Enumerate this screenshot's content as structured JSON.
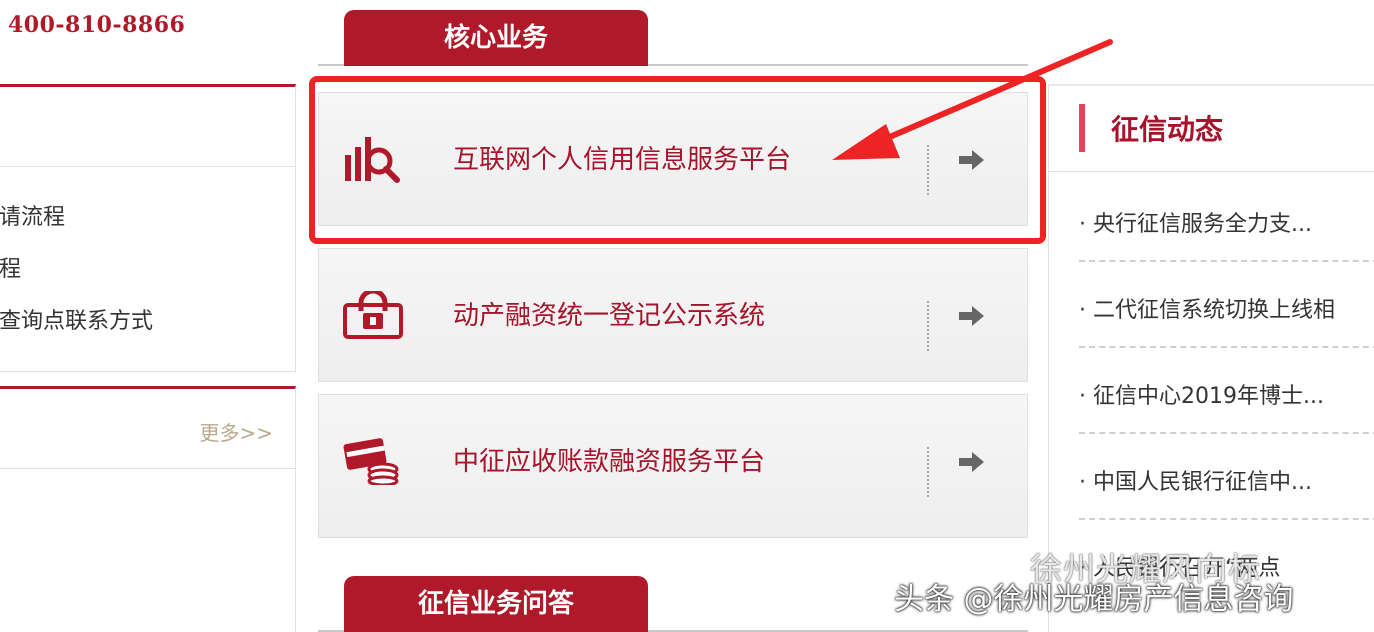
{
  "header": {
    "phone": "400-810-8866"
  },
  "left": {
    "links": [
      "请流程",
      "程",
      "查询点联系方式"
    ],
    "more": "更多>>"
  },
  "center": {
    "tab_top": "核心业务",
    "tab_bottom": "征信业务问答",
    "rows": [
      {
        "label": "互联网个人信用信息服务平台",
        "icon": "chart-search-icon"
      },
      {
        "label": "动产融资统一登记公示系统",
        "icon": "lock-certificate-icon"
      },
      {
        "label": "中征应收账款融资服务平台",
        "icon": "card-coins-icon"
      }
    ],
    "arrow_icon": "right-arrow-icon"
  },
  "right": {
    "title": "征信动态",
    "news": [
      "· 央行征信服务全力支...",
      "· 二代征信系统切换上线相",
      "· 征信中心2019年博士...",
      "· 中国人民银行征信中...",
      "· 人民银行召开“两点"
    ]
  },
  "watermark": {
    "top": "徐州光耀风向标",
    "bottom": "头条 @徐州光耀房产信息咨询"
  },
  "colors": {
    "brand": "#b0192a",
    "highlight": "#ee2424"
  }
}
